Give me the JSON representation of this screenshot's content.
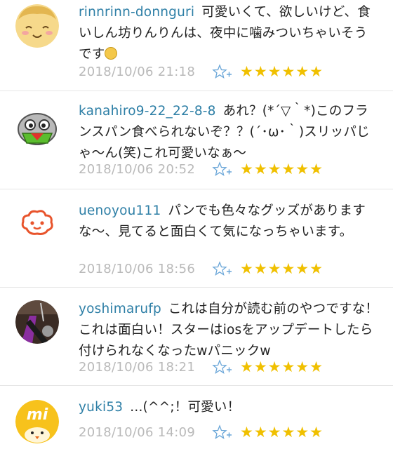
{
  "colors": {
    "username": "#2e7fa6",
    "timestamp": "#b9b9b9",
    "star": "#f0c000",
    "star_add_icon": "#6aa6d8"
  },
  "comments": [
    {
      "username": "rinnrinn-donnguri",
      "text": "可愛いくて、欲しいけど、食いしん坊りんりんは、夜中に噛みついちゃいそうです",
      "timestamp": "2018/10/06 21:18",
      "stars": "★★★★★★",
      "avatar": "smiling-face-avatar"
    },
    {
      "username": "kanahiro9-22_22-8-8",
      "text": "あれ？(*´▽｀*)このフランスパン食べられないぞ？？(´･ω･｀)スリッパじゃ〜ん(笑)これ可愛いなぁ〜",
      "timestamp": "2018/10/06 20:52",
      "stars": "★★★★★★",
      "avatar": "robot-face-avatar"
    },
    {
      "username": "uenoyou111",
      "text": "パンでも色々なグッズがありますな〜、見てると面白くて気になっちゃいます。",
      "timestamp": "2018/10/06 18:56",
      "stars": "★★★★★★",
      "avatar": "cloud-face-avatar"
    },
    {
      "username": "yoshimarufp",
      "text": "これは自分が読む前のやつですな！これは面白い！スターはiosをアップデートしたら付けられなくなったwパニックw",
      "timestamp": "2018/10/06 18:21",
      "stars": "★★★★★★",
      "avatar": "guitar-photo-avatar"
    },
    {
      "username": "yuki53",
      "text": "...(^^;！可愛い！",
      "timestamp": "2018/10/06 14:09",
      "stars": "★★★★★★",
      "avatar": "chick-mi-avatar"
    }
  ]
}
